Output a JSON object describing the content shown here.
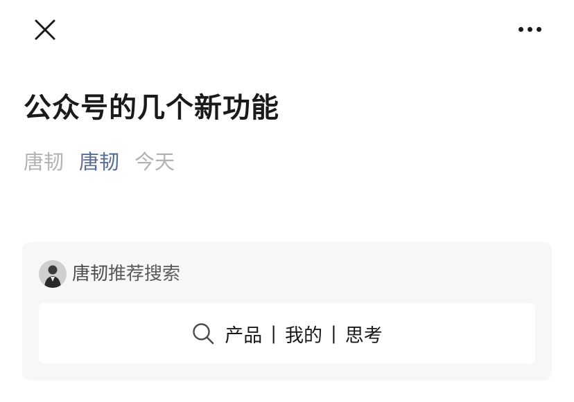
{
  "toolbar": {
    "close_icon": "close-icon",
    "more_icon": "more-dots-icon"
  },
  "article": {
    "title": "公众号的几个新功能",
    "author": "唐韧",
    "account_name": "唐韧",
    "date": "今天"
  },
  "recommend": {
    "account_name": "唐韧",
    "label": "推荐搜索",
    "search_icon": "search-icon",
    "terms": [
      "产品",
      "我的",
      "思考"
    ],
    "separator": "|"
  },
  "colors": {
    "account_link": "#576b95",
    "muted_text": "#b2b2b2",
    "card_bg": "#f7f7f7"
  }
}
